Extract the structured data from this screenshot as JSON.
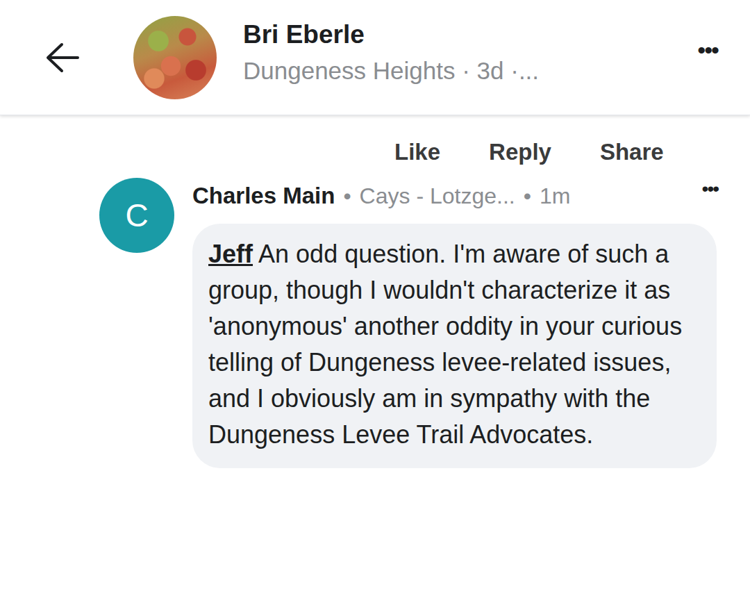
{
  "header": {
    "title": "Bri Eberle",
    "subtitle": "Dungeness Heights · 3d ·...",
    "menu": "•••"
  },
  "actions": [
    "Like",
    "Reply",
    "Share"
  ],
  "comment": {
    "avatar_letter": "C",
    "author": "Charles Main",
    "separator": "•",
    "group": "Cays - Lotzge...",
    "time": "1m",
    "menu": "•••",
    "mention": "Jeff",
    "text": "An odd question.  I'm aware of such a group, though I wouldn't characterize it as 'anonymous' another oddity in your curious telling of Dungeness levee-related issues, and I obviously am in sympathy with the Dungeness Levee Trail Advocates."
  }
}
